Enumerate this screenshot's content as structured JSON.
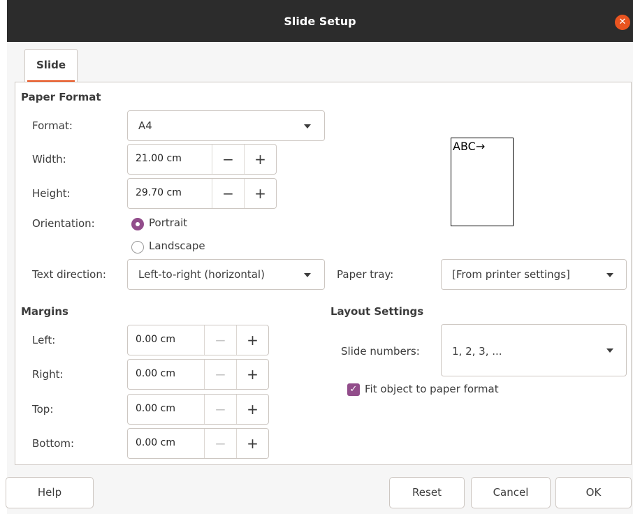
{
  "window": {
    "title": "Slide Setup",
    "close_glyph": "✕"
  },
  "tabs": [
    {
      "label": "Slide",
      "active": true
    }
  ],
  "paper_format": {
    "heading": "Paper Format",
    "format_label": "Format:",
    "format_value": "A4",
    "width_label": "Width:",
    "width_value": "21.00 cm",
    "height_label": "Height:",
    "height_value": "29.70 cm",
    "orientation_label": "Orientation:",
    "orientation_options": [
      {
        "label": "Portrait",
        "selected": true
      },
      {
        "label": "Landscape",
        "selected": false
      }
    ],
    "text_direction_label": "Text direction:",
    "text_direction_value": "Left-to-right (horizontal)",
    "paper_tray_label": "Paper tray:",
    "paper_tray_value": "[From printer settings]",
    "preview_text": "ABC→"
  },
  "margins": {
    "heading": "Margins",
    "left_label": "Left:",
    "left_value": "0.00 cm",
    "right_label": "Right:",
    "right_value": "0.00 cm",
    "top_label": "Top:",
    "top_value": "0.00 cm",
    "bottom_label": "Bottom:",
    "bottom_value": "0.00 cm"
  },
  "layout_settings": {
    "heading": "Layout Settings",
    "slide_numbers_label": "Slide numbers:",
    "slide_numbers_value": "1, 2, 3, ...",
    "fit_object_label": "Fit object to paper format",
    "fit_object_checked": true
  },
  "spin_glyphs": {
    "minus": "−",
    "plus": "+"
  },
  "check_glyph": "✓",
  "buttons": {
    "help": "Help",
    "reset": "Reset",
    "cancel": "Cancel",
    "ok": "OK"
  },
  "colors": {
    "accent": "#e95420",
    "check": "#924d8b",
    "titlebar": "#2c2c2c"
  }
}
